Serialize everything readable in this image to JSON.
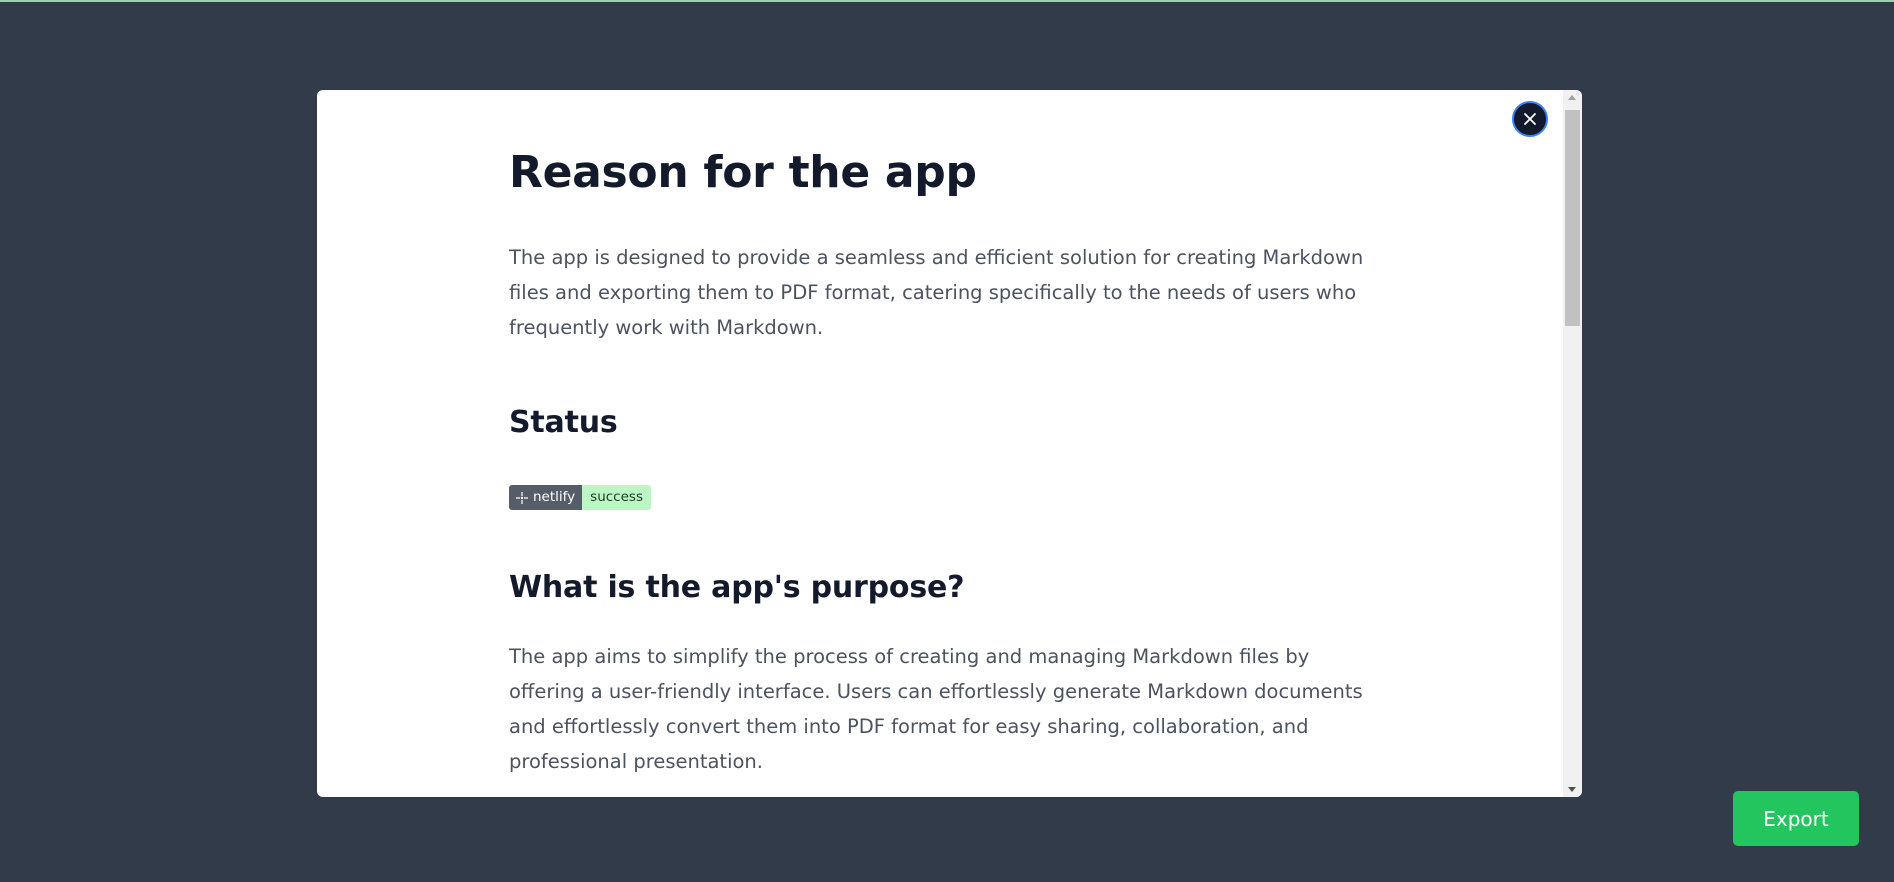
{
  "modal": {
    "title": "Reason for the app",
    "intro": "The app is designed to provide a seamless and efficient solution for creating Markdown files and exporting them to PDF format, catering specifically to the needs of users who frequently work with Markdown.",
    "status_heading": "Status",
    "badge": {
      "icon": "netlify-icon",
      "label": "netlify",
      "status": "success",
      "label_color": "#555d69",
      "status_color": "#bdf5c4"
    },
    "purpose_heading": "What is the app's purpose?",
    "purpose_text": "The app aims to simplify the process of creating and managing Markdown files by offering a user-friendly interface. Users can effortlessly generate Markdown documents and effortlessly convert them into PDF format for easy sharing, collaboration, and professional presentation.",
    "close_icon": "close-icon"
  },
  "actions": {
    "export_label": "Export"
  },
  "colors": {
    "backdrop": "#323b4a",
    "accent": "#22c55e",
    "heading": "#121a2b",
    "focus_ring": "#3b82f6"
  }
}
